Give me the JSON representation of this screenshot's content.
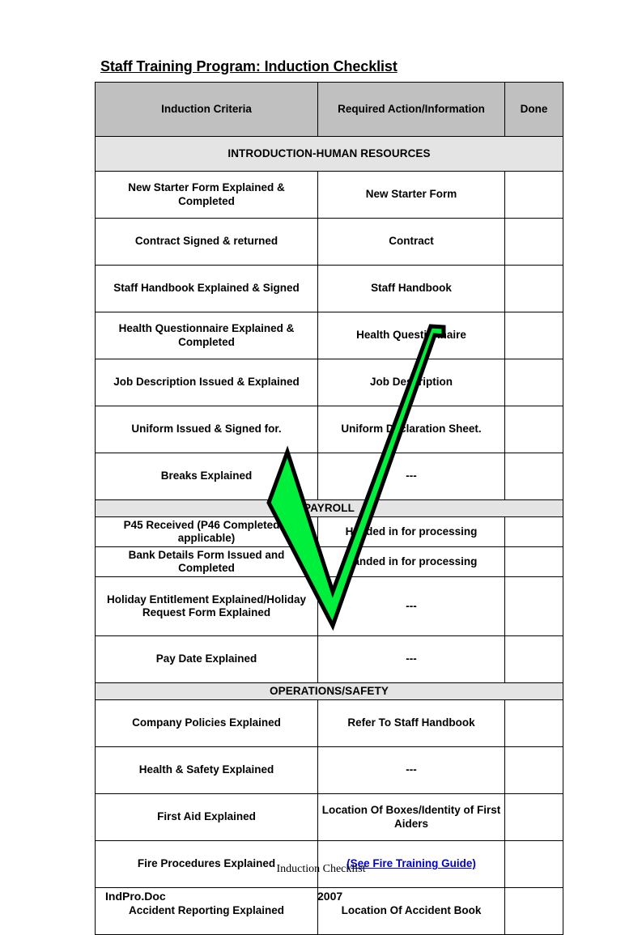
{
  "document": {
    "title": "Staff Training Program: Induction Checklist"
  },
  "table": {
    "columns": [
      {
        "key": "criteria",
        "label": "Induction Criteria"
      },
      {
        "key": "action",
        "label": "Required Action/Information"
      },
      {
        "key": "done",
        "label": "Done"
      }
    ],
    "sections": [
      {
        "heading": "INTRODUCTION-HUMAN RESOURCES",
        "rows": [
          {
            "criteria": "New Starter Form Explained & Completed",
            "action": "New Starter Form",
            "done": ""
          },
          {
            "criteria": "Contract Signed & returned",
            "action": "Contract",
            "done": ""
          },
          {
            "criteria": "Staff Handbook Explained & Signed",
            "action": "Staff Handbook",
            "done": ""
          },
          {
            "criteria": "Health Questionnaire Explained & Completed",
            "action": "Health Questionnaire",
            "done": ""
          },
          {
            "criteria": "Job Description Issued & Explained",
            "action": "Job Description",
            "done": ""
          },
          {
            "criteria": "Uniform Issued & Signed for.",
            "action": "Uniform Declaration Sheet.",
            "done": ""
          },
          {
            "criteria": "Breaks Explained",
            "action": "---",
            "done": ""
          }
        ]
      },
      {
        "heading": "PAYROLL",
        "rows": [
          {
            "criteria": "P45 Received (P46 Completed if applicable)",
            "action": "Handed in for processing",
            "done": ""
          },
          {
            "criteria": "Bank Details Form Issued and Completed",
            "action": "Handed in for processing",
            "done": ""
          },
          {
            "criteria": "Holiday Entitlement Explained/Holiday Request Form Explained",
            "action": "---",
            "done": ""
          },
          {
            "criteria": "Pay Date Explained",
            "action": "---",
            "done": ""
          }
        ]
      },
      {
        "heading": "OPERATIONS/SAFETY",
        "rows": [
          {
            "criteria": "Company Policies Explained",
            "action": "Refer To Staff Handbook",
            "done": ""
          },
          {
            "criteria": "Health & Safety Explained",
            "action": "---",
            "done": ""
          },
          {
            "criteria": "First Aid Explained",
            "action": "Location Of Boxes/Identity of First Aiders",
            "done": ""
          },
          {
            "criteria": "Fire Procedures Explained",
            "action": "(See Fire Training Guide)",
            "action_is_link": true,
            "done": ""
          },
          {
            "criteria": "Accident Reporting Explained",
            "action": "Location Of Accident Book",
            "done": ""
          }
        ]
      }
    ]
  },
  "annotation": {
    "shape": "green-check-mark"
  },
  "footer": {
    "center_note": "Induction Checklist",
    "doc_name": "IndPro.Doc",
    "year": "2007"
  },
  "colors": {
    "header_fill": "#C0C0C0",
    "section_fill": "#E4E4E4",
    "border": "#000000",
    "link": "#0000CC",
    "check_fill": "#00EE3C",
    "check_stroke": "#000000",
    "page_background": "#FFFFFF"
  }
}
